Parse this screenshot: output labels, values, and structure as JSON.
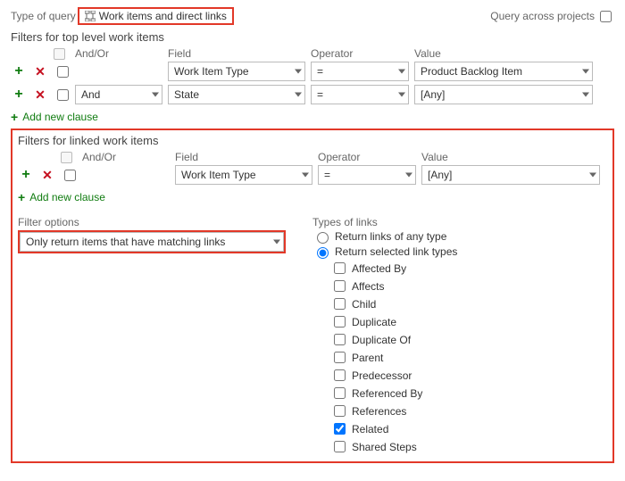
{
  "top": {
    "type_label": "Type of query",
    "query_type": "Work items and direct links",
    "across_label": "Query across projects",
    "across_checked": false
  },
  "top_filters": {
    "title": "Filters for top level work items",
    "headers": {
      "andor": "And/Or",
      "field": "Field",
      "operator": "Operator",
      "value": "Value"
    },
    "rows": [
      {
        "andor": "",
        "field": "Work Item Type",
        "operator": "=",
        "value": "Product Backlog Item"
      },
      {
        "andor": "And",
        "field": "State",
        "operator": "=",
        "value": "[Any]"
      }
    ],
    "add_clause": "Add new clause"
  },
  "linked_filters": {
    "title": "Filters for linked work items",
    "headers": {
      "andor": "And/Or",
      "field": "Field",
      "operator": "Operator",
      "value": "Value"
    },
    "rows": [
      {
        "andor": "",
        "field": "Work Item Type",
        "operator": "=",
        "value": "[Any]"
      }
    ],
    "add_clause": "Add new clause",
    "filter_options_label": "Filter options",
    "filter_options_value": "Only return items that have matching links",
    "types_label": "Types of links",
    "radio_any": "Return links of any type",
    "radio_selected": "Return selected link types",
    "radio_choice": "selected",
    "link_types": [
      {
        "label": "Affected By",
        "checked": false
      },
      {
        "label": "Affects",
        "checked": false
      },
      {
        "label": "Child",
        "checked": false
      },
      {
        "label": "Duplicate",
        "checked": false
      },
      {
        "label": "Duplicate Of",
        "checked": false
      },
      {
        "label": "Parent",
        "checked": false
      },
      {
        "label": "Predecessor",
        "checked": false
      },
      {
        "label": "Referenced By",
        "checked": false
      },
      {
        "label": "References",
        "checked": false
      },
      {
        "label": "Related",
        "checked": true
      },
      {
        "label": "Shared Steps",
        "checked": false
      }
    ]
  }
}
